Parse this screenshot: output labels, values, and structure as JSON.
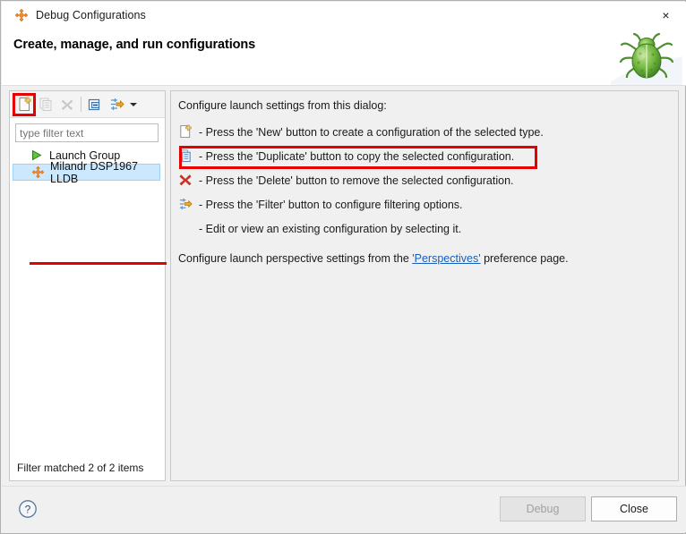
{
  "window": {
    "title": "Debug Configurations",
    "title_icon": "debug-configurations-icon",
    "close_glyph": "×"
  },
  "header": {
    "title": "Create, manage, and run configurations",
    "decoration_icon": "green-bug-icon"
  },
  "left_pane": {
    "toolbar": [
      {
        "name": "new-launch-configuration-button",
        "icon": "new-file-icon",
        "label": "New",
        "enabled": true,
        "highlighted": true
      },
      {
        "name": "duplicate-button",
        "icon": "duplicate-icon",
        "label": "Duplicate",
        "enabled": false,
        "highlighted": false
      },
      {
        "name": "delete-button",
        "icon": "delete-x-icon",
        "label": "Delete",
        "enabled": false,
        "highlighted": false
      },
      {
        "name": "collapse-all-button",
        "icon": "collapse-all-icon",
        "label": "Collapse All",
        "enabled": true,
        "highlighted": false
      },
      {
        "name": "filter-button",
        "icon": "filter-icon",
        "label": "Filter",
        "enabled": true,
        "highlighted": false
      },
      {
        "name": "toolbar-menu-button",
        "icon": "chevron-down-icon",
        "label": "Menu",
        "enabled": true,
        "highlighted": false
      }
    ],
    "filter_input": {
      "placeholder": "type filter text",
      "value": ""
    },
    "tree_items": [
      {
        "label": "Launch Group",
        "icon": "launch-group-icon",
        "selected": false,
        "annotated": false
      },
      {
        "label": "Milandr DSP1967 LLDB",
        "icon": "milandr-config-icon",
        "selected": true,
        "annotated": true
      }
    ],
    "status": "Filter matched 2 of 2 items"
  },
  "right_pane": {
    "intro": "Configure launch settings from this dialog:",
    "rows": [
      {
        "icon": "new-file-icon",
        "text": "- Press the 'New' button to create a configuration of the selected type.",
        "annotated": true
      },
      {
        "icon": "duplicate-icon",
        "text": "- Press the 'Duplicate' button to copy the selected configuration.",
        "annotated": false
      },
      {
        "icon": "delete-x-icon",
        "text": "- Press the 'Delete' button to remove the selected configuration.",
        "annotated": false
      },
      {
        "icon": "filter-icon",
        "text": "- Press the 'Filter' button to configure filtering options.",
        "annotated": false
      },
      {
        "icon": "",
        "text": "- Edit or view an existing configuration by selecting it.",
        "annotated": false
      }
    ],
    "footer_prefix": "Configure launch perspective settings from the ",
    "footer_link": "'Perspectives'",
    "footer_suffix": " preference page."
  },
  "footer": {
    "help_icon": "help-question-icon",
    "debug_button": "Debug",
    "close_button": "Close",
    "debug_enabled": false
  },
  "colors": {
    "annotation_red": "#e60000",
    "selection_blue": "#cce8ff",
    "link_blue": "#1560bd",
    "panel_gray": "#f0f0f0"
  }
}
